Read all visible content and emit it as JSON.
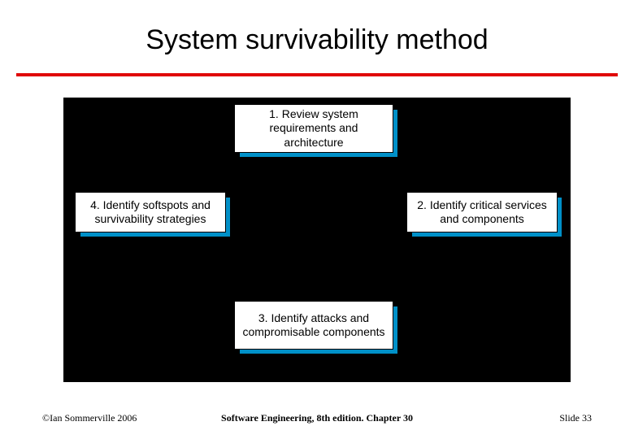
{
  "title": "System survivability method",
  "boxes": {
    "step1": "1. Review system requirements and architecture",
    "step2": "2. Identify critical services and components",
    "step3": "3. Identify attacks and compromisable components",
    "step4": "4. Identify softspots and survivability strategies"
  },
  "footer": {
    "left": "©Ian Sommerville 2006",
    "center": "Software Engineering, 8th edition. Chapter 30",
    "right": "Slide 33"
  },
  "colors": {
    "accent_rule": "#e00808",
    "box_shadow": "#0090c8",
    "diagram_bg": "#000000"
  }
}
